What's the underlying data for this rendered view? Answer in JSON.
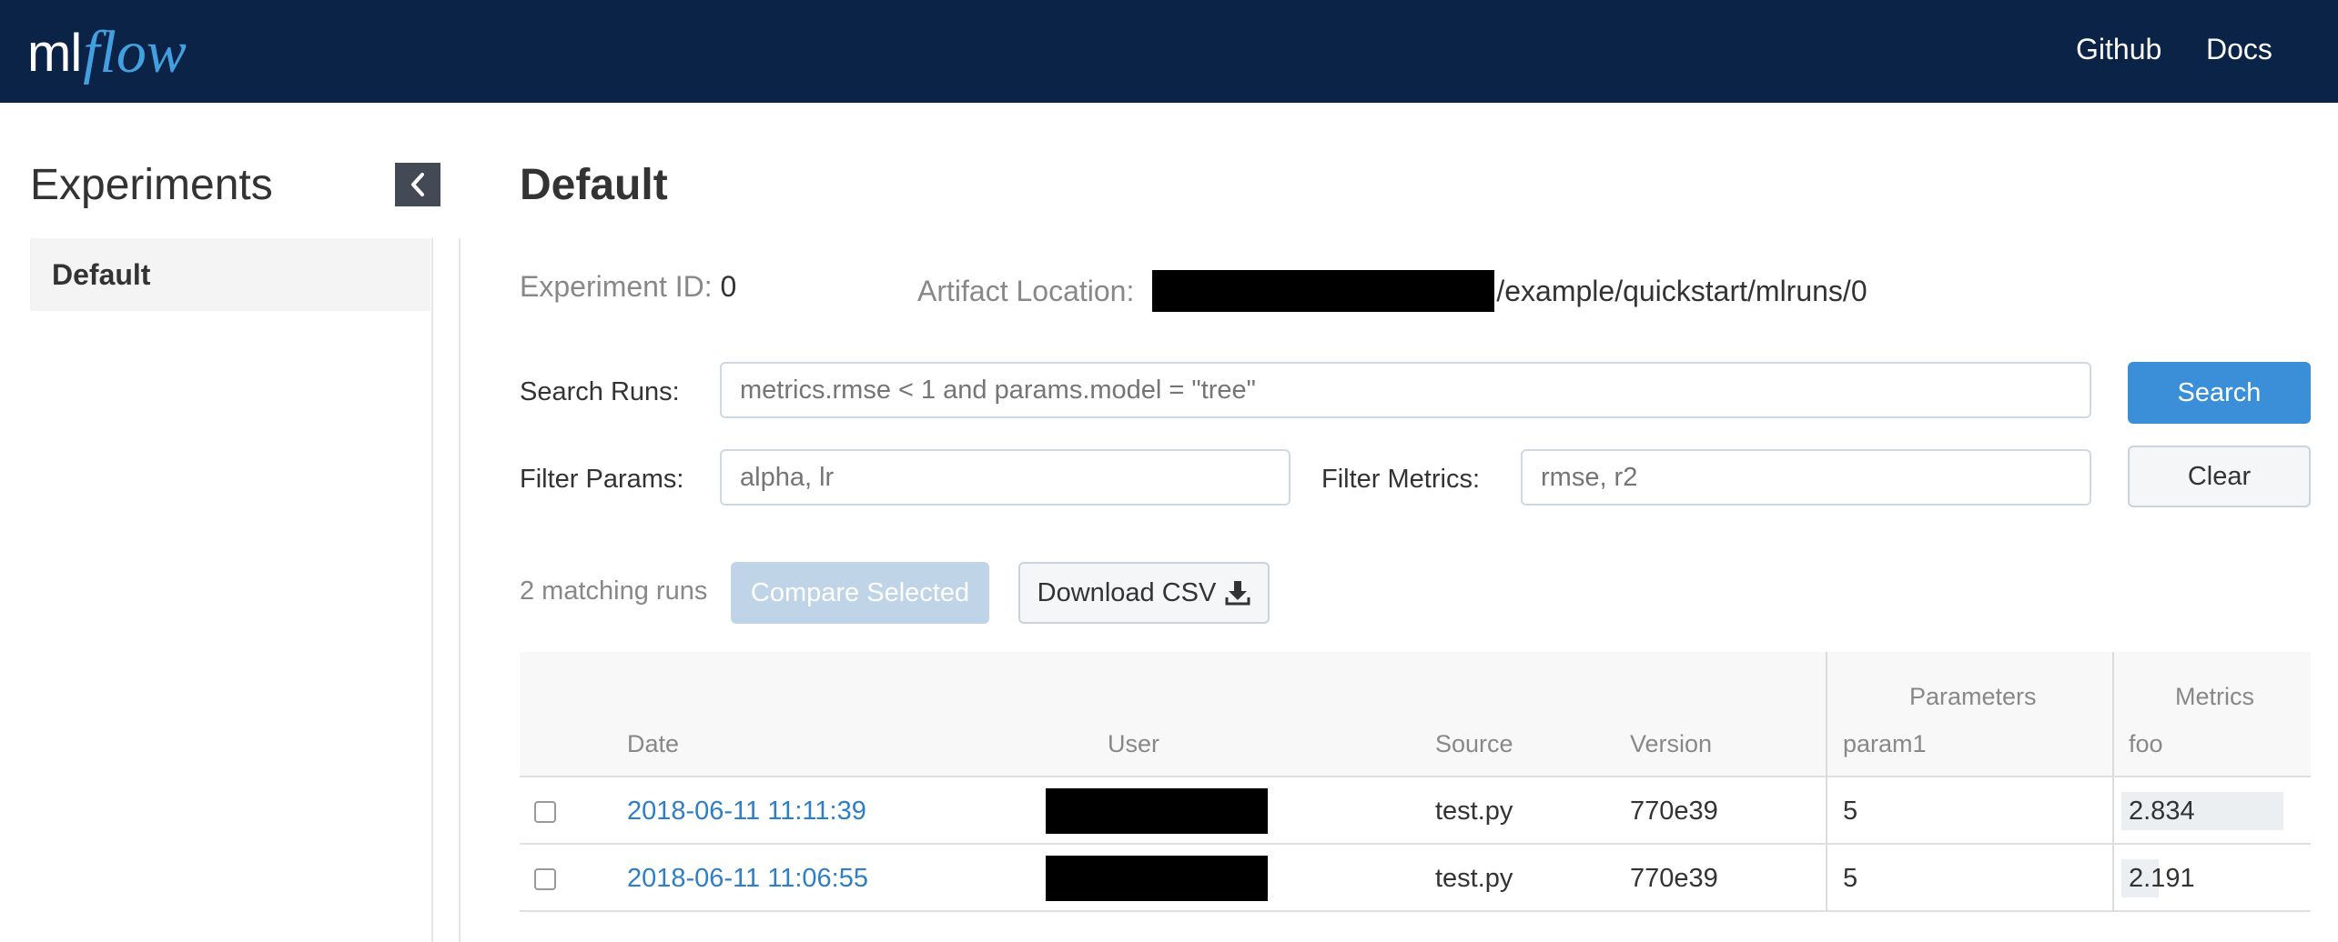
{
  "header": {
    "logo_ml": "ml",
    "logo_flow": "flow",
    "nav": [
      {
        "label": "Github"
      },
      {
        "label": "Docs"
      }
    ]
  },
  "sidebar": {
    "title": "Experiments",
    "items": [
      {
        "label": "Default",
        "selected": true
      }
    ]
  },
  "main": {
    "title": "Default",
    "experiment_id_label": "Experiment ID:",
    "experiment_id": "0",
    "artifact_label": "Artifact Location:",
    "artifact_suffix": "/example/quickstart/mlruns/0",
    "search_label": "Search Runs:",
    "search_placeholder": "metrics.rmse < 1 and params.model = \"tree\"",
    "search_button": "Search",
    "filter_params_label": "Filter Params:",
    "filter_params_placeholder": "alpha, lr",
    "filter_metrics_label": "Filter Metrics:",
    "filter_metrics_placeholder": "rmse, r2",
    "clear_button": "Clear",
    "matching_runs": "2 matching runs",
    "compare_button": "Compare Selected",
    "download_button": "Download CSV"
  },
  "table": {
    "group_headers": {
      "parameters": "Parameters",
      "metrics": "Metrics"
    },
    "columns": {
      "date": "Date",
      "user": "User",
      "source": "Source",
      "version": "Version",
      "param1": "param1",
      "foo": "foo"
    },
    "rows": [
      {
        "date": "2018-06-11 11:11:39",
        "source": "test.py",
        "version": "770e39",
        "param1": "5",
        "foo": "2.834",
        "foo_fraction": 1.0
      },
      {
        "date": "2018-06-11 11:06:55",
        "source": "test.py",
        "version": "770e39",
        "param1": "5",
        "foo": "2.191",
        "foo_fraction": 0.23
      }
    ]
  },
  "colors": {
    "header_bg": "#0b2346",
    "logo_accent": "#43a0e0",
    "primary_button": "#3b8fd8",
    "link": "#2e7ec8"
  }
}
